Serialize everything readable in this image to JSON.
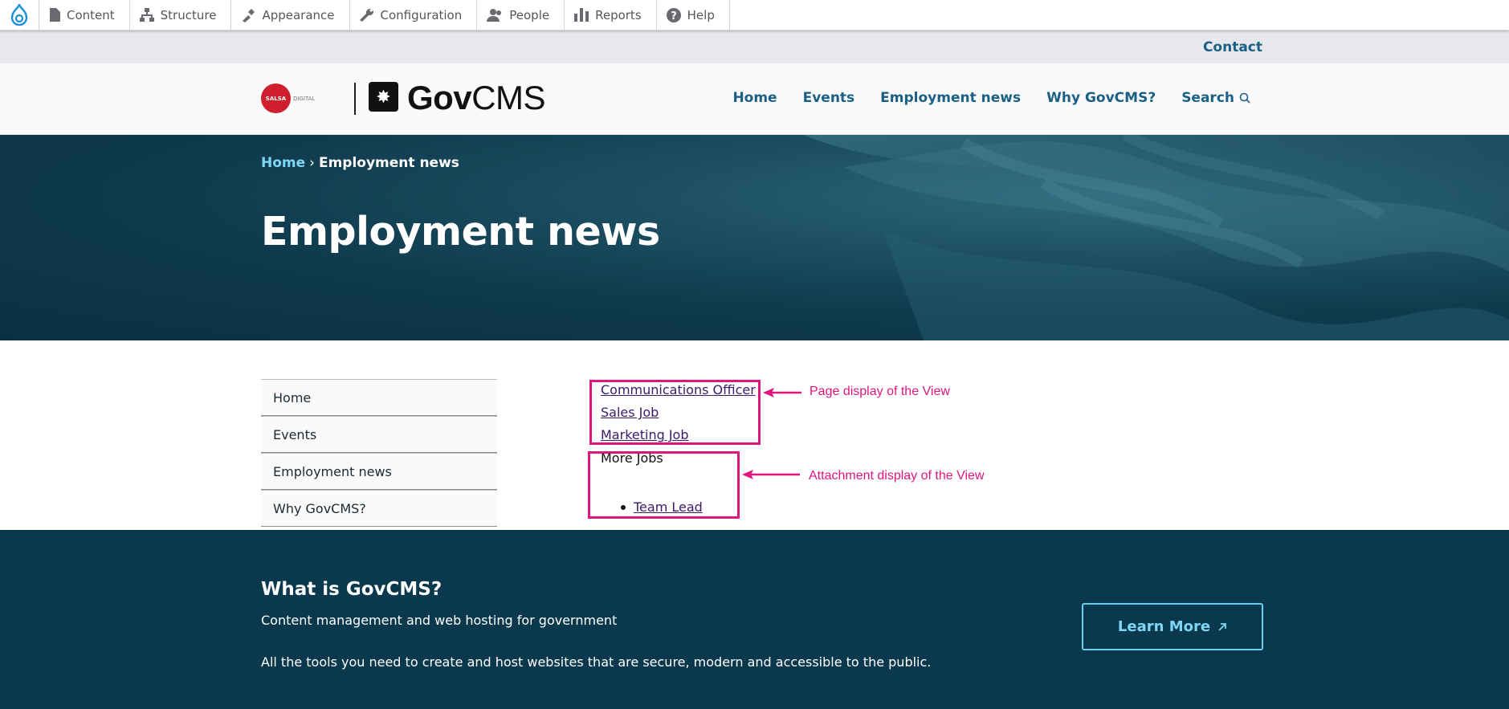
{
  "toolbar": {
    "items": [
      {
        "label": "Content",
        "icon": "file-icon"
      },
      {
        "label": "Structure",
        "icon": "sitemap-icon"
      },
      {
        "label": "Appearance",
        "icon": "paintbrush-icon"
      },
      {
        "label": "Configuration",
        "icon": "wrench-icon"
      },
      {
        "label": "People",
        "icon": "people-icon"
      },
      {
        "label": "Reports",
        "icon": "bar-chart-icon"
      },
      {
        "label": "Help",
        "icon": "help-icon"
      }
    ]
  },
  "secondary_nav": {
    "contact": "Contact"
  },
  "header": {
    "salsa_mark": "SALSA",
    "salsa_digital": "DIGITAL",
    "gov_bold": "Gov",
    "gov_regular": "CMS",
    "nav": [
      "Home",
      "Events",
      "Employment news",
      "Why GovCMS?"
    ],
    "search_label": "Search"
  },
  "hero": {
    "breadcrumb_home": "Home",
    "breadcrumb_sep": "›",
    "breadcrumb_current": "Employment news",
    "title": "Employment news"
  },
  "sidebar": {
    "items": [
      "Home",
      "Events",
      "Employment news",
      "Why GovCMS?"
    ]
  },
  "view": {
    "page_links": [
      "Communications Officer",
      "Sales Job",
      "Marketing Job"
    ],
    "attachment_heading": "More Jobs",
    "attachment_links": [
      "Team Lead"
    ]
  },
  "annotations": {
    "page_display": "Page display of the View",
    "attachment_display": "Attachment display of the View",
    "color": "#e0167d"
  },
  "footer": {
    "heading": "What is GovCMS?",
    "line1": "Content management and web hosting for government",
    "line2": "All the tools you need to create and host websites that are secure, modern and accessible to the public.",
    "button": "Learn More"
  },
  "colors": {
    "link_blue": "#1a5f85",
    "hero_dark": "#0b3042",
    "footer_bg": "#0a394d",
    "accent_cyan": "#6ccff0"
  }
}
